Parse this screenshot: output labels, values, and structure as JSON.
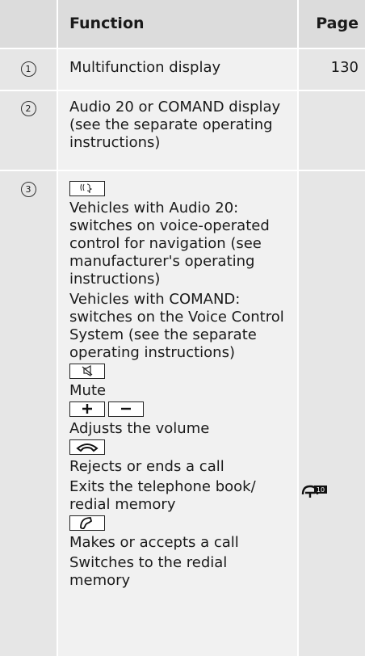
{
  "header": {
    "function": "Function",
    "page": "Page"
  },
  "rows": [
    {
      "num": "1",
      "text": "Multifunction display",
      "page": "130"
    },
    {
      "num": "2",
      "text": "Audio 20 or COMAND display (see the separate operating instructions)",
      "page": ""
    },
    {
      "num": "3",
      "voice_a": "Vehicles with Audio 20: switches on voice-operated control for navigation (see manufacturer's operating instructions)",
      "voice_b": "Vehicles with COMAND: switches on the Voice Control System (see the separate operating instructions)",
      "mute": "Mute",
      "volume": "Adjusts the volume",
      "reject_1": "Rejects or ends a call",
      "reject_2": "Exits the telephone book/ redial memory",
      "accept_1": "Makes or accepts a call",
      "accept_2": "Switches to the redial memory"
    }
  ],
  "icons": [
    "voice-control-icon",
    "mute-icon",
    "plus-icon",
    "minus-icon",
    "hang-up-icon",
    "phone-icon",
    "steering-wheel-page-icon"
  ]
}
